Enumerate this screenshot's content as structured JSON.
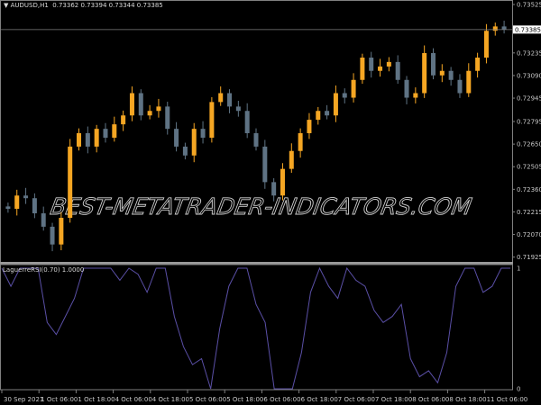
{
  "header": {
    "symbol": "AUDUSD,H1",
    "ohlc": "0.73362 0.73394 0.73344 0.73385"
  },
  "indicator": {
    "label": "LaguerreRSI(0.70) 1.0000"
  },
  "watermark": "BEST-METATRADER-INDICATORS.COM",
  "colors": {
    "bull": "#f5a623",
    "bear": "#5f7384",
    "rsi": "#5a4fa6",
    "grid": "#808080",
    "background": "#000000"
  },
  "chart_data": [
    {
      "type": "candlestick",
      "symbol": "AUDUSD",
      "timeframe": "H1",
      "first_open": 0.7225,
      "closes": [
        0.72235,
        0.7232,
        0.72303,
        0.72206,
        0.7212,
        0.72006,
        0.72177,
        0.72634,
        0.7272,
        0.72634,
        0.72748,
        0.72691,
        0.72777,
        0.72834,
        0.72977,
        0.72834,
        0.72863,
        0.72891,
        0.72748,
        0.72634,
        0.72577,
        0.72748,
        0.72691,
        0.7292,
        0.72977,
        0.72891,
        0.72863,
        0.7272,
        0.72634,
        0.72406,
        0.7232,
        0.72491,
        0.72606,
        0.7272,
        0.72806,
        0.72863,
        0.72834,
        0.72977,
        0.72948,
        0.73062,
        0.73205,
        0.7312,
        0.73148,
        0.73177,
        0.73062,
        0.72948,
        0.72977,
        0.73234,
        0.73091,
        0.7312,
        0.73062,
        0.72977,
        0.7312,
        0.73205,
        0.73377,
        0.73405,
        0.73385
      ],
      "current_price": "0.73385",
      "ylim": [
        0.719,
        0.7354
      ],
      "y_ticks": [
        "0.73525",
        "0.73235",
        "0.73090",
        "0.72945",
        "0.72795",
        "0.72650",
        "0.72505",
        "0.72360",
        "0.72215",
        "0.72070",
        "0.71925"
      ],
      "x_ticks": [
        "30 Sep 2021",
        "1 Oct 06:00",
        "1 Oct 18:00",
        "4 Oct 06:00",
        "4 Oct 18:00",
        "5 Oct 06:00",
        "5 Oct 18:00",
        "6 Oct 06:00",
        "6 Oct 18:00",
        "7 Oct 06:00",
        "7 Oct 18:00",
        "8 Oct 06:00",
        "8 Oct 18:00",
        "11 Oct 06:00"
      ]
    },
    {
      "type": "line",
      "name": "LaguerreRSI(0.70)",
      "values": [
        1,
        0.85,
        1,
        1,
        1,
        0.55,
        0.45,
        0.6,
        0.75,
        1,
        1,
        1,
        1,
        0.9,
        1,
        0.95,
        0.8,
        1,
        1,
        0.6,
        0.35,
        0.2,
        0.25,
        0,
        0.5,
        0.85,
        1,
        1,
        0.7,
        0.55,
        0,
        0,
        0,
        0.3,
        0.8,
        1,
        0.85,
        0.75,
        1,
        0.9,
        0.85,
        0.65,
        0.55,
        0.6,
        0.7,
        0.25,
        0.1,
        0.15,
        0.05,
        0.3,
        0.85,
        1,
        1,
        0.8,
        0.85,
        1,
        1
      ],
      "ylim": [
        0,
        1
      ],
      "y_ticks": [
        "1",
        "0"
      ]
    }
  ]
}
